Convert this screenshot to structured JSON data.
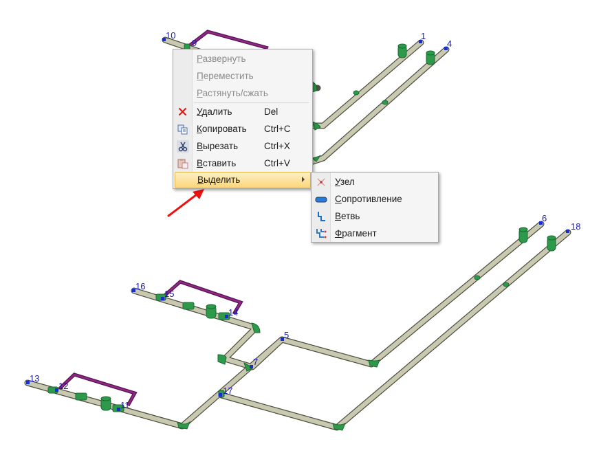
{
  "nodes": [
    "10",
    "9",
    "1",
    "4",
    "6",
    "18",
    "16",
    "15",
    "14",
    "5",
    "7",
    "17",
    "13",
    "12",
    "11"
  ],
  "context_menu": {
    "items": [
      {
        "label": "Развернуть",
        "disabled": true
      },
      {
        "label": "Переместить",
        "disabled": true
      },
      {
        "label": "Растянуть/сжать",
        "disabled": true
      },
      {
        "label": "Удалить",
        "shortcut": "Del",
        "icon": "delete-x-icon"
      },
      {
        "label": "Копировать",
        "shortcut": "Ctrl+C",
        "icon": "copy-icon"
      },
      {
        "label": "Вырезать",
        "shortcut": "Ctrl+X",
        "icon": "cut-scissors-icon"
      },
      {
        "label": "Вставить",
        "shortcut": "Ctrl+V",
        "icon": "paste-icon"
      },
      {
        "label": "Выделить",
        "submenu": true,
        "highlighted": true
      }
    ]
  },
  "submenu": {
    "items": [
      {
        "label": "Узел",
        "icon": "node-icon"
      },
      {
        "label": "Сопротивление",
        "icon": "resistance-icon"
      },
      {
        "label": "Ветвь",
        "icon": "branch-icon"
      },
      {
        "label": "Фрагмент",
        "icon": "fragment-icon"
      }
    ]
  },
  "colors": {
    "pipe": "#c9c8b0",
    "pipe_outline": "#4e4e3e",
    "fitting": "#2c9a4a",
    "bypass": "#7a1a6e",
    "node_marker": "#1a2ec8",
    "menu_highlight": "#fbd67a",
    "pointer_arrow": "#ee1111"
  }
}
